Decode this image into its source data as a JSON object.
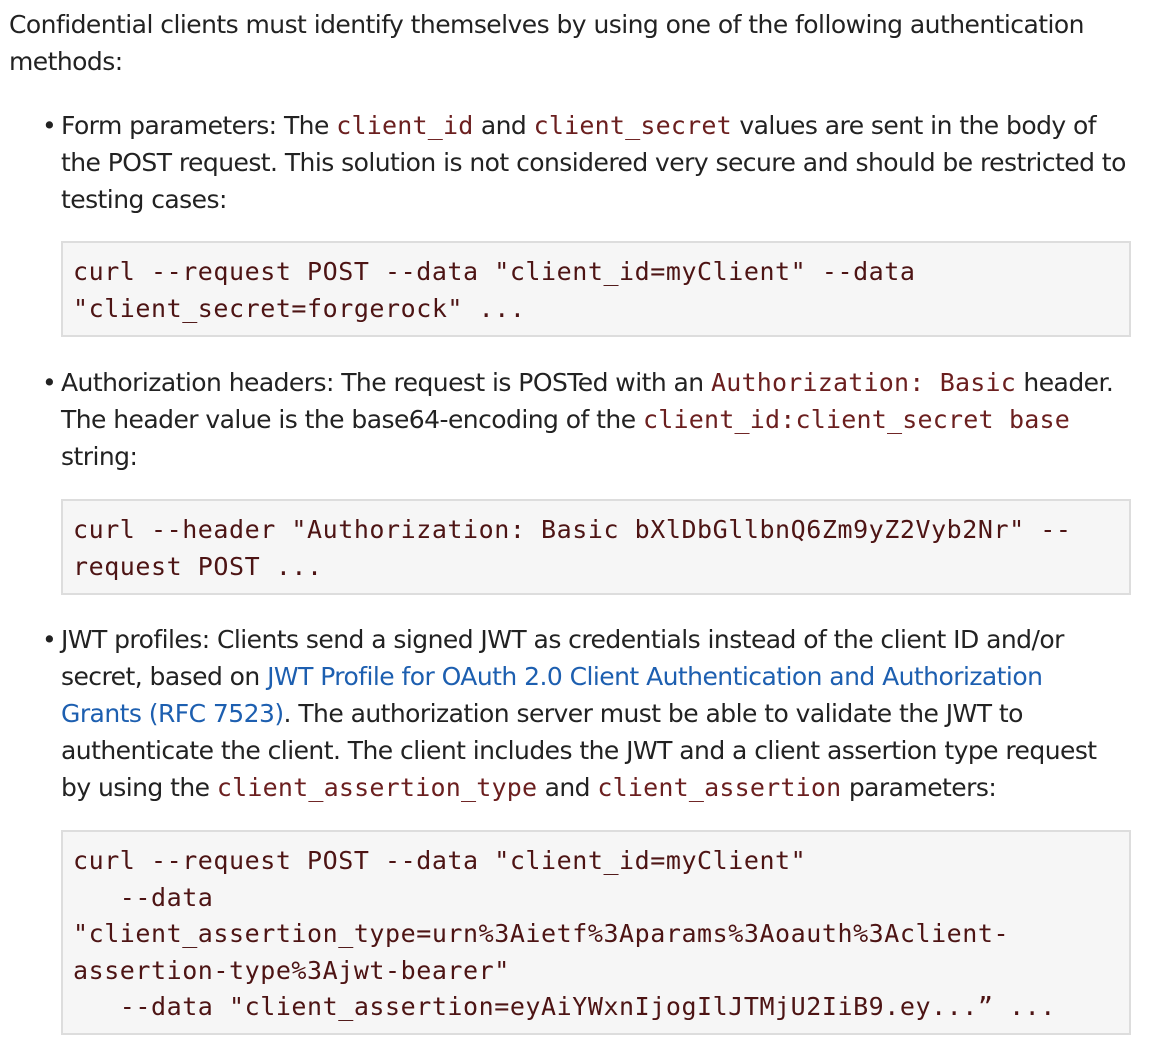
{
  "intro": "Confidential clients must identify themselves by using one of the following authentication methods:",
  "bullet_glyph": "•",
  "items": [
    {
      "b1_text1": "Form parameters: The ",
      "b1_code1": "client_id",
      "b1_text2": " and ",
      "b1_code2": "client_secret",
      "b1_text3": " values are sent in the body of the POST request. This solution is not considered very secure and should be restricted to testing cases:",
      "code_lines": [
        "curl --request POST --data \"client_id=myClient\" --data",
        "\"client_secret=forgerock\" ..."
      ]
    },
    {
      "b2_text1": "Authorization headers: The request is POSTed with an ",
      "b2_code1": "Authorization: Basic",
      "b2_text2": " header. The header value is the base64-encoding of the ",
      "b2_code2": "client_id:client_secret base",
      "b2_text3": " string:",
      "code_lines": [
        "curl --header \"Authorization: Basic bXlDbGllbnQ6Zm9yZ2Vyb2Nr\" --",
        "request POST ..."
      ]
    },
    {
      "b3_text1": "JWT profiles: Clients send a signed JWT as credentials instead of the client ID and/or secret, based on ",
      "b3_link": "JWT Profile for OAuth 2.0 Client Authentication and Authorization Grants (RFC 7523)",
      "b3_text2": ". The authorization server must be able to validate the JWT to authenticate the client. The client includes the JWT and a client assertion type request by using the ",
      "b3_code1": "client_assertion_type",
      "b3_text3": " and ",
      "b3_code2": "client_assertion",
      "b3_text4": " parameters:",
      "code_lines": [
        "curl --request POST --data \"client_id=myClient\"",
        "   --data",
        "\"client_assertion_type=urn%3Aietf%3Aparams%3Aoauth%3Aclient-",
        "assertion-type%3Ajwt-bearer\"",
        "   --data \"client_assertion=eyAiYWxnIjogIlJTMjU2IiB9.ey...” ..."
      ]
    }
  ]
}
